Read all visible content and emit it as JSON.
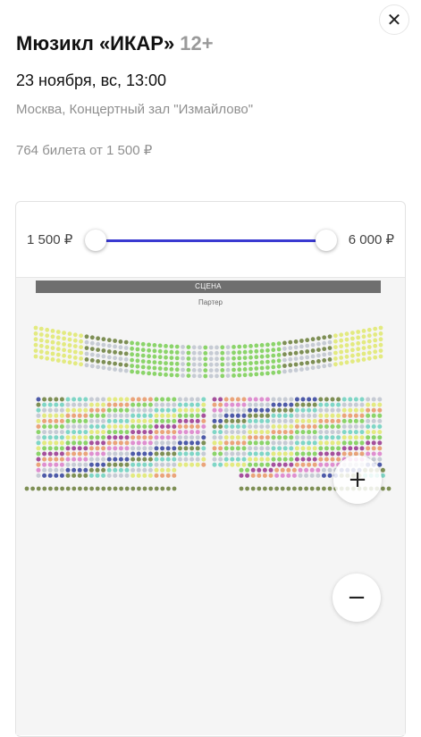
{
  "event": {
    "title": "Мюзикл «ИКАР»",
    "age_rating": "12+",
    "datetime": "23 ноября, вс, 13:00",
    "venue": "Москва, Концертный зал \"Измайлово\"",
    "tickets_summary": "764 билета от 1 500 ₽"
  },
  "price_filter": {
    "min_label": "1 500 ₽",
    "max_label": "6 000 ₽",
    "selected_min_fraction": 0,
    "selected_max_fraction": 1,
    "accent_color": "#3a3ad1"
  },
  "seat_map": {
    "stage_label": "СЦЕНА",
    "section_label": "Партер",
    "seat_colors": {
      "yellow": "#e3ea80",
      "green": "#8bd46a",
      "dark_olive": "#7e8f55",
      "grey": "#c6cbd4",
      "navy": "#4d5aa8",
      "teal": "#7fd6c6",
      "orange": "#eaa47a",
      "pink": "#df8fd0",
      "purple": "#a5509c"
    },
    "zoom_in_label": "+",
    "zoom_out_label": "−"
  },
  "icons": {
    "close": "close-icon",
    "zoom_in": "plus-icon",
    "zoom_out": "minus-icon"
  }
}
